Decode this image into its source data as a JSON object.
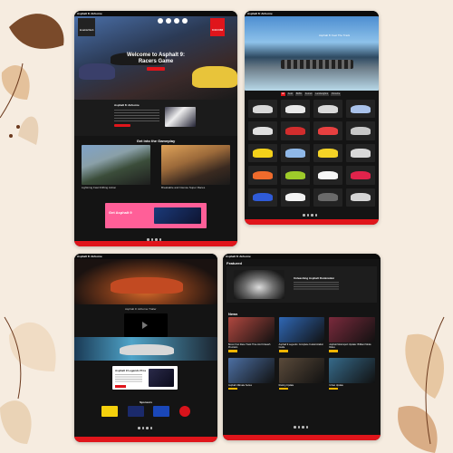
{
  "colors": {
    "background": "#f6ece0",
    "card": "#141414",
    "accent_red": "#e0151b",
    "accent_yellow": "#f0b400",
    "pink": "#ff5f98"
  },
  "card1": {
    "brand": "Asphalt 8: Airborne",
    "logo_text": "EnableWeb",
    "timer": "0:24:158",
    "hero_title": "Welcome to Asphalt 9:",
    "hero_subtitle": "Racers Game",
    "about_title": "Asphalt 8: Airborne",
    "gameplay_title": "Get into the Gameplay",
    "gameplay_left_caption": "Lightning Fast Drifting Action",
    "gameplay_right_caption": "Breakable and Intense Super Races",
    "promo_title": "Get Asphalt 9",
    "icons": [
      "trophy-icon",
      "medal-icon",
      "steering-wheel-icon",
      "gear-icon"
    ]
  },
  "card2": {
    "brand": "Asphalt 8: Airborne",
    "hero_title": "Asphalt 8: Feel The Track",
    "filter_tabs": [
      "All",
      "Audi",
      "BMW",
      "Ferrari",
      "Lamborghini",
      "Porsche"
    ],
    "car_colors": [
      "#d8d8d8",
      "#e8e8e8",
      "#d9d9d9",
      "#a9c2ea",
      "#e0e0e0",
      "#d22d2d",
      "#e84040",
      "#c8c8c8",
      "#f3d11a",
      "#8fb8e8",
      "#f4d326",
      "#d8d8d8",
      "#ef6b2c",
      "#9ecb2a",
      "#f7f7f7",
      "#e1234b",
      "#2f5bd8",
      "#f3f3f3",
      "#6a6a6a",
      "#d5d5d5"
    ]
  },
  "card3": {
    "brand": "Asphalt 8: Airborne",
    "video_caption": "Asphalt 9: Airborne Trailer",
    "info_title": "Asphalt 9 Legends Pros",
    "sponsors_title": "Sponsors",
    "sponsors": [
      {
        "name": "Shell",
        "color": "#f4d00c"
      },
      {
        "name": "Redbull",
        "color": "#1b2a6b"
      },
      {
        "name": "Pepsi",
        "color": "#1a47b8"
      },
      {
        "name": "Coca-Cola",
        "color": "#d8131b"
      }
    ]
  },
  "card4": {
    "brand": "Asphalt 8: Airborne",
    "featured_label": "Featured",
    "featured_title": "Unleashing Asphalt Domination",
    "news_label": "News",
    "news_items": [
      {
        "title": "Boost Your Race Track Time And Unleash Precision",
        "color": "#b0473f"
      },
      {
        "title": "Asphalt 9 Legends: Complete Customization Guide",
        "color": "#2f67b5"
      },
      {
        "title": "Asphalt Motorsport Update: Brilliant Mode Rides",
        "color": "#7a2a3c"
      },
      {
        "title": "Asphalt Ultimate Series",
        "color": "#4c6fa3"
      },
      {
        "title": "Racing Update",
        "color": "#5a4a3a"
      },
      {
        "title": "Urban Update",
        "color": "#366a8a"
      }
    ]
  }
}
